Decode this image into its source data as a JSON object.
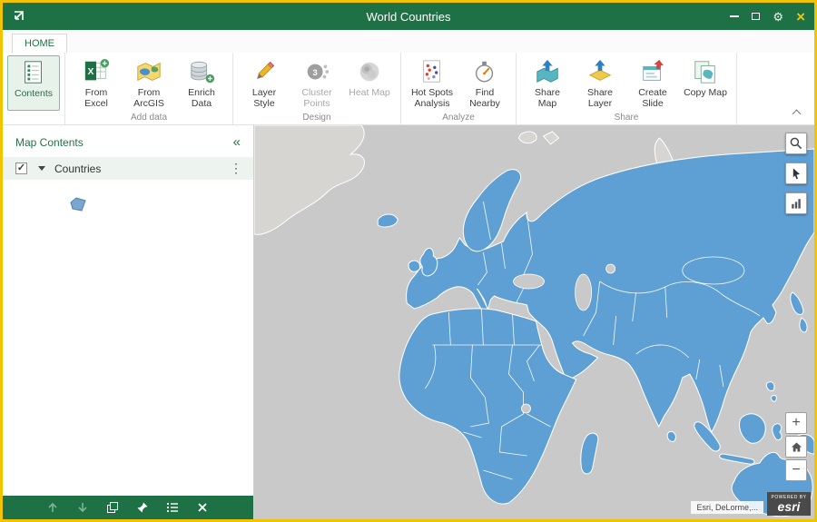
{
  "window": {
    "title": "World Countries"
  },
  "tabs": {
    "home": "HOME"
  },
  "ribbon": {
    "contents": {
      "label": "Contents"
    },
    "cluster_badge": "3",
    "groups": [
      {
        "label": "Add data",
        "buttons": [
          {
            "label": "From Excel"
          },
          {
            "label": "From ArcGIS"
          },
          {
            "label": "Enrich Data"
          }
        ]
      },
      {
        "label": "Design",
        "buttons": [
          {
            "label": "Layer Style"
          },
          {
            "label": "Cluster Points",
            "disabled": true
          },
          {
            "label": "Heat Map",
            "disabled": true
          }
        ]
      },
      {
        "label": "Analyze",
        "buttons": [
          {
            "label": "Hot Spots Analysis"
          },
          {
            "label": "Find Nearby"
          }
        ]
      },
      {
        "label": "Share",
        "buttons": [
          {
            "label": "Share Map"
          },
          {
            "label": "Share Layer"
          },
          {
            "label": "Create Slide"
          },
          {
            "label": "Copy Map"
          }
        ]
      }
    ]
  },
  "sidebar": {
    "title": "Map Contents",
    "layer": {
      "name": "Countries",
      "checked": true
    }
  },
  "map": {
    "attribution": "Esri, DeLorme,...",
    "logo": {
      "powered_by": "POWERED BY",
      "brand": "esri"
    },
    "zoom_in": "+",
    "zoom_out": "−"
  },
  "icons": {
    "settings": "⚙",
    "close": "×",
    "kebab": "⋮",
    "collapse_panel": "«",
    "check": "✓"
  },
  "colors": {
    "accent_green": "#1E7145",
    "country_fill": "#5E9FD4",
    "frame_yellow": "#F2C400"
  }
}
